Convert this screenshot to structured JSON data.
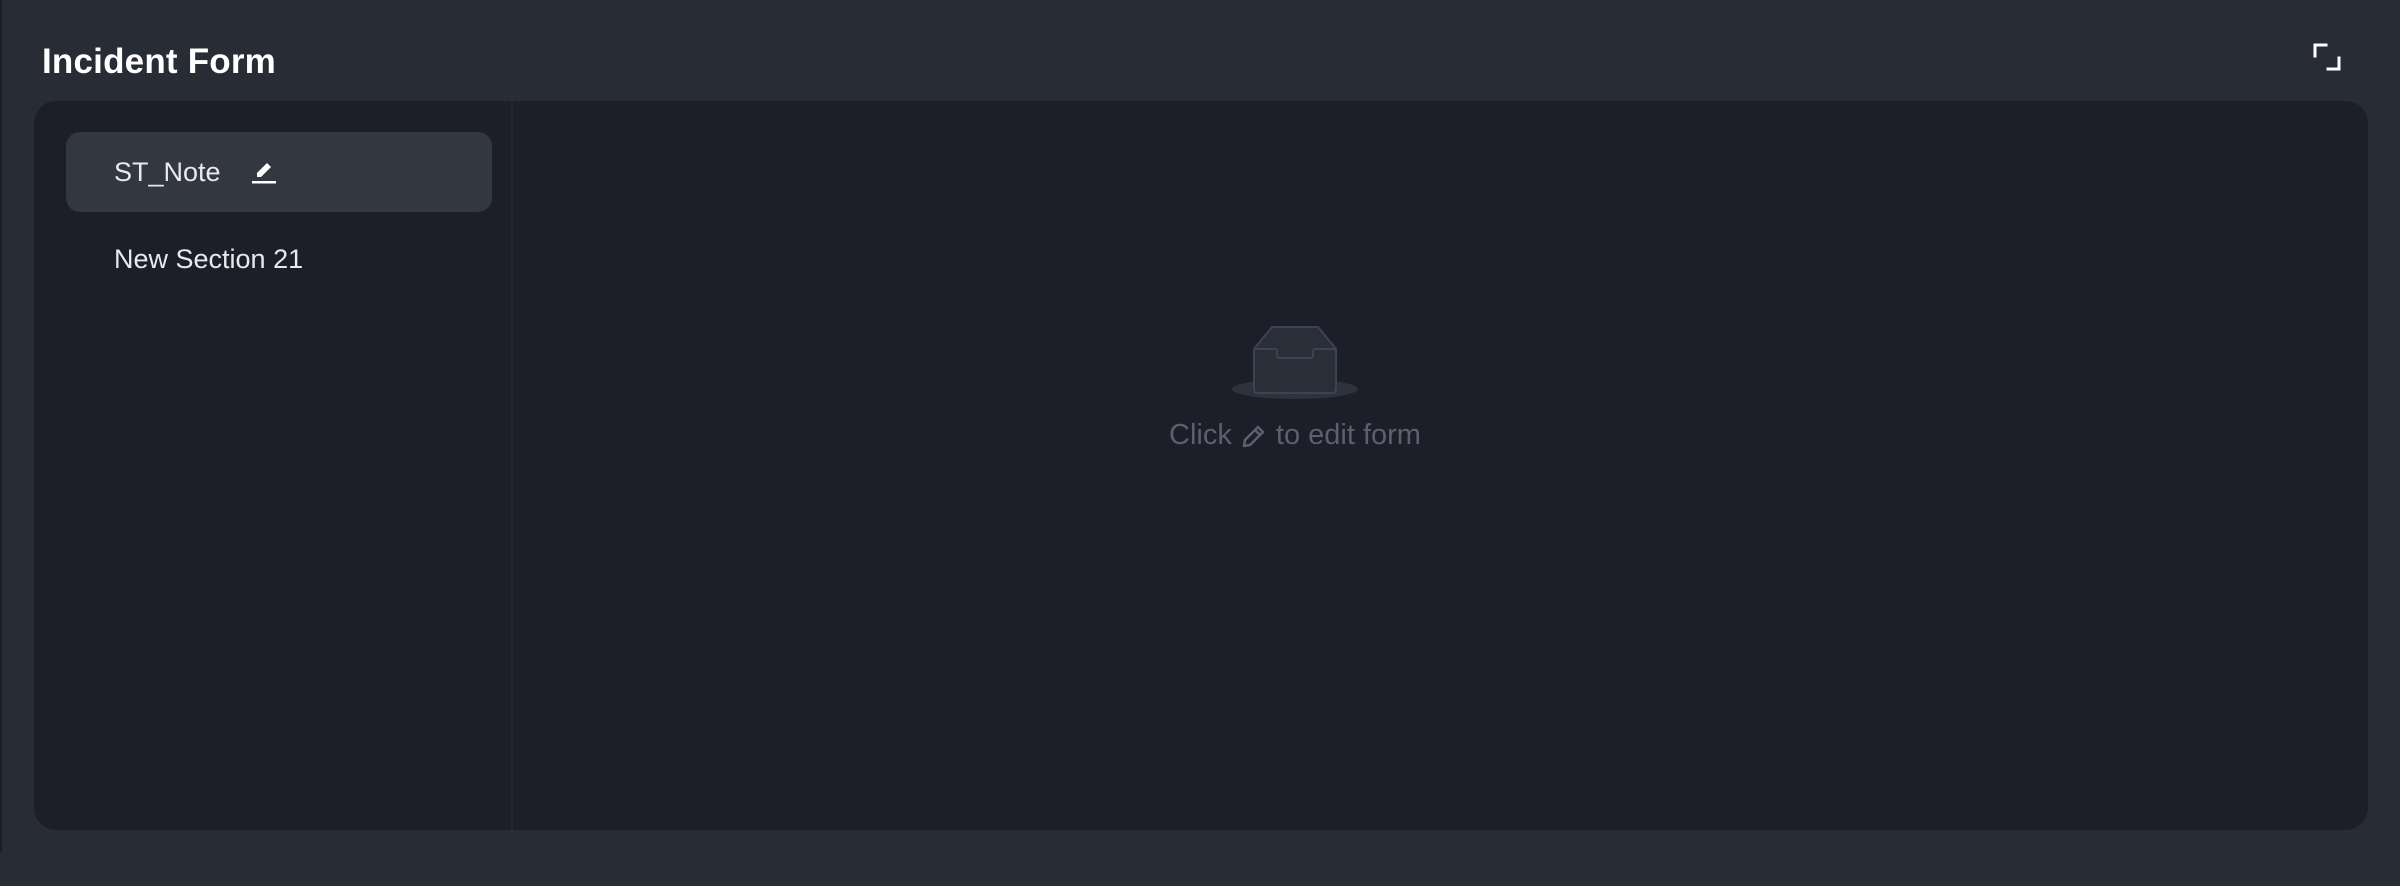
{
  "header": {
    "title": "Incident Form",
    "expand_icon": "expand-icon"
  },
  "sidebar": {
    "items": [
      {
        "label": "ST_Note",
        "active": true,
        "icon": "edit-icon"
      },
      {
        "label": "New Section 21",
        "active": false
      }
    ]
  },
  "main": {
    "empty_icon": "inbox-icon",
    "empty_prefix": "Click",
    "empty_inline_icon": "pencil-icon",
    "empty_suffix": "to edit form"
  },
  "colors": {
    "background": "#282c35",
    "panel": "#1c1f29",
    "active_item": "#333741",
    "muted_text": "#5b606c"
  }
}
